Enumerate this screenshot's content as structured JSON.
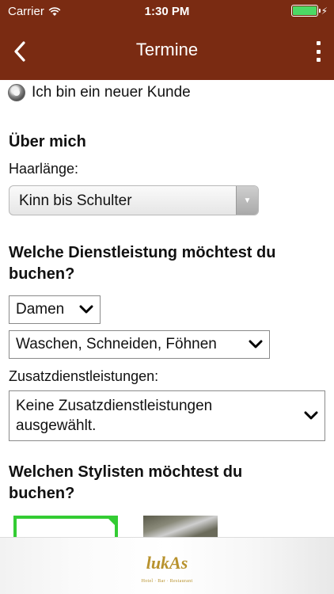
{
  "status": {
    "carrier": "Carrier",
    "time": "1:30 PM"
  },
  "nav": {
    "title": "Termine"
  },
  "radio": {
    "label": "Ich bin ein neuer Kunde"
  },
  "about": {
    "heading": "Über mich",
    "hair_label": "Haarlänge:",
    "hair_value": "Kinn bis Schulter"
  },
  "service": {
    "heading_line1": "Welche Dienstleistung möchtest du",
    "heading_line2": "buchen?",
    "category": "Damen",
    "service": "Waschen, Schneiden, Föhnen",
    "extra_label": "Zusatzdienstleistungen:",
    "extra_line1": "Keine Zusatzdienstleistungen",
    "extra_line2": "ausgewählt."
  },
  "stylist": {
    "heading_line1": "Welchen Stylisten möchtest du",
    "heading_line2": "buchen?"
  },
  "footer": {
    "logo_name": "lukAs",
    "logo_sub": "Hotel · Bar · Restaurant"
  },
  "colors": {
    "nav_bg": "#7a2b12",
    "battery": "#4cd964",
    "selected_border": "#33cc33",
    "logo": "#b8922d"
  }
}
